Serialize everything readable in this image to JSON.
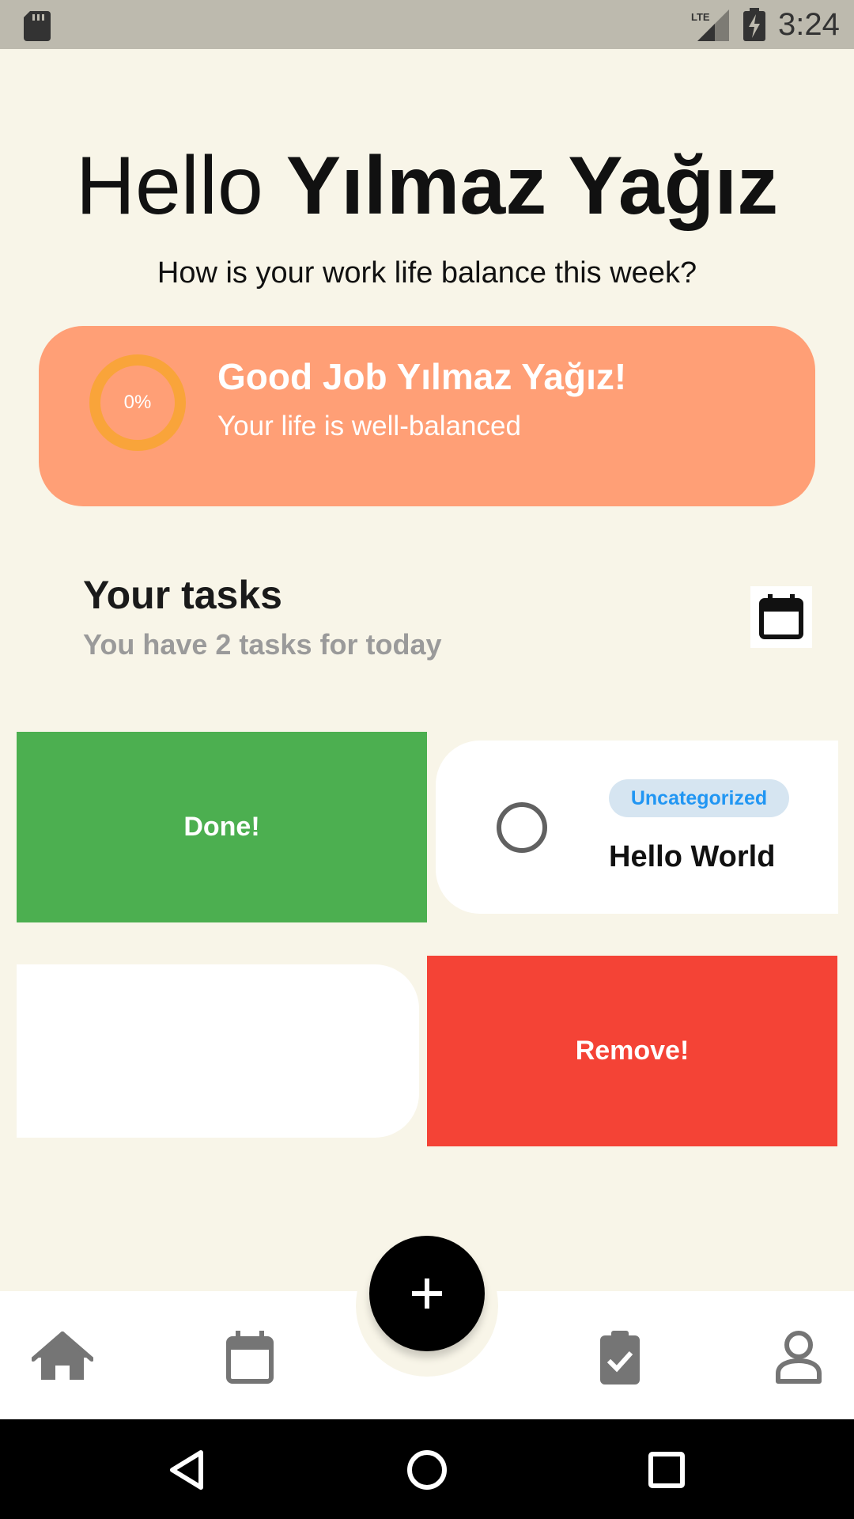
{
  "status_bar": {
    "time": "3:24",
    "network": "LTE",
    "icons": [
      "sd-card-icon",
      "lte-signal-icon",
      "battery-charging-icon"
    ]
  },
  "header": {
    "greeting_prefix": "Hello",
    "user_name": "Yılmaz Yağız",
    "subtitle": "How is your work life balance this week?"
  },
  "balance_card": {
    "progress_label": "0%",
    "progress_value": 0,
    "title": "Good Job Yılmaz Yağız!",
    "message": "Your life is well-balanced",
    "color": "#ff9f76",
    "ring_color": "#f9a43a"
  },
  "tasks": {
    "title": "Your tasks",
    "count_text": "You have 2 tasks for today",
    "calendar_icon": "calendar-icon",
    "items": [
      {
        "category": "Uncategorized",
        "title": "Hello World",
        "done_label": "Done!",
        "done_color": "#4caf50"
      },
      {
        "category": "",
        "title": "",
        "remove_label": "Remove!",
        "remove_color": "#f44336"
      }
    ]
  },
  "bottom_nav": {
    "items": [
      "home-icon",
      "calendar-icon",
      "task-check-icon",
      "profile-icon"
    ],
    "fab_icon": "plus-icon"
  },
  "system_nav": {
    "items": [
      "back-icon",
      "home-circle-icon",
      "recents-icon"
    ]
  }
}
